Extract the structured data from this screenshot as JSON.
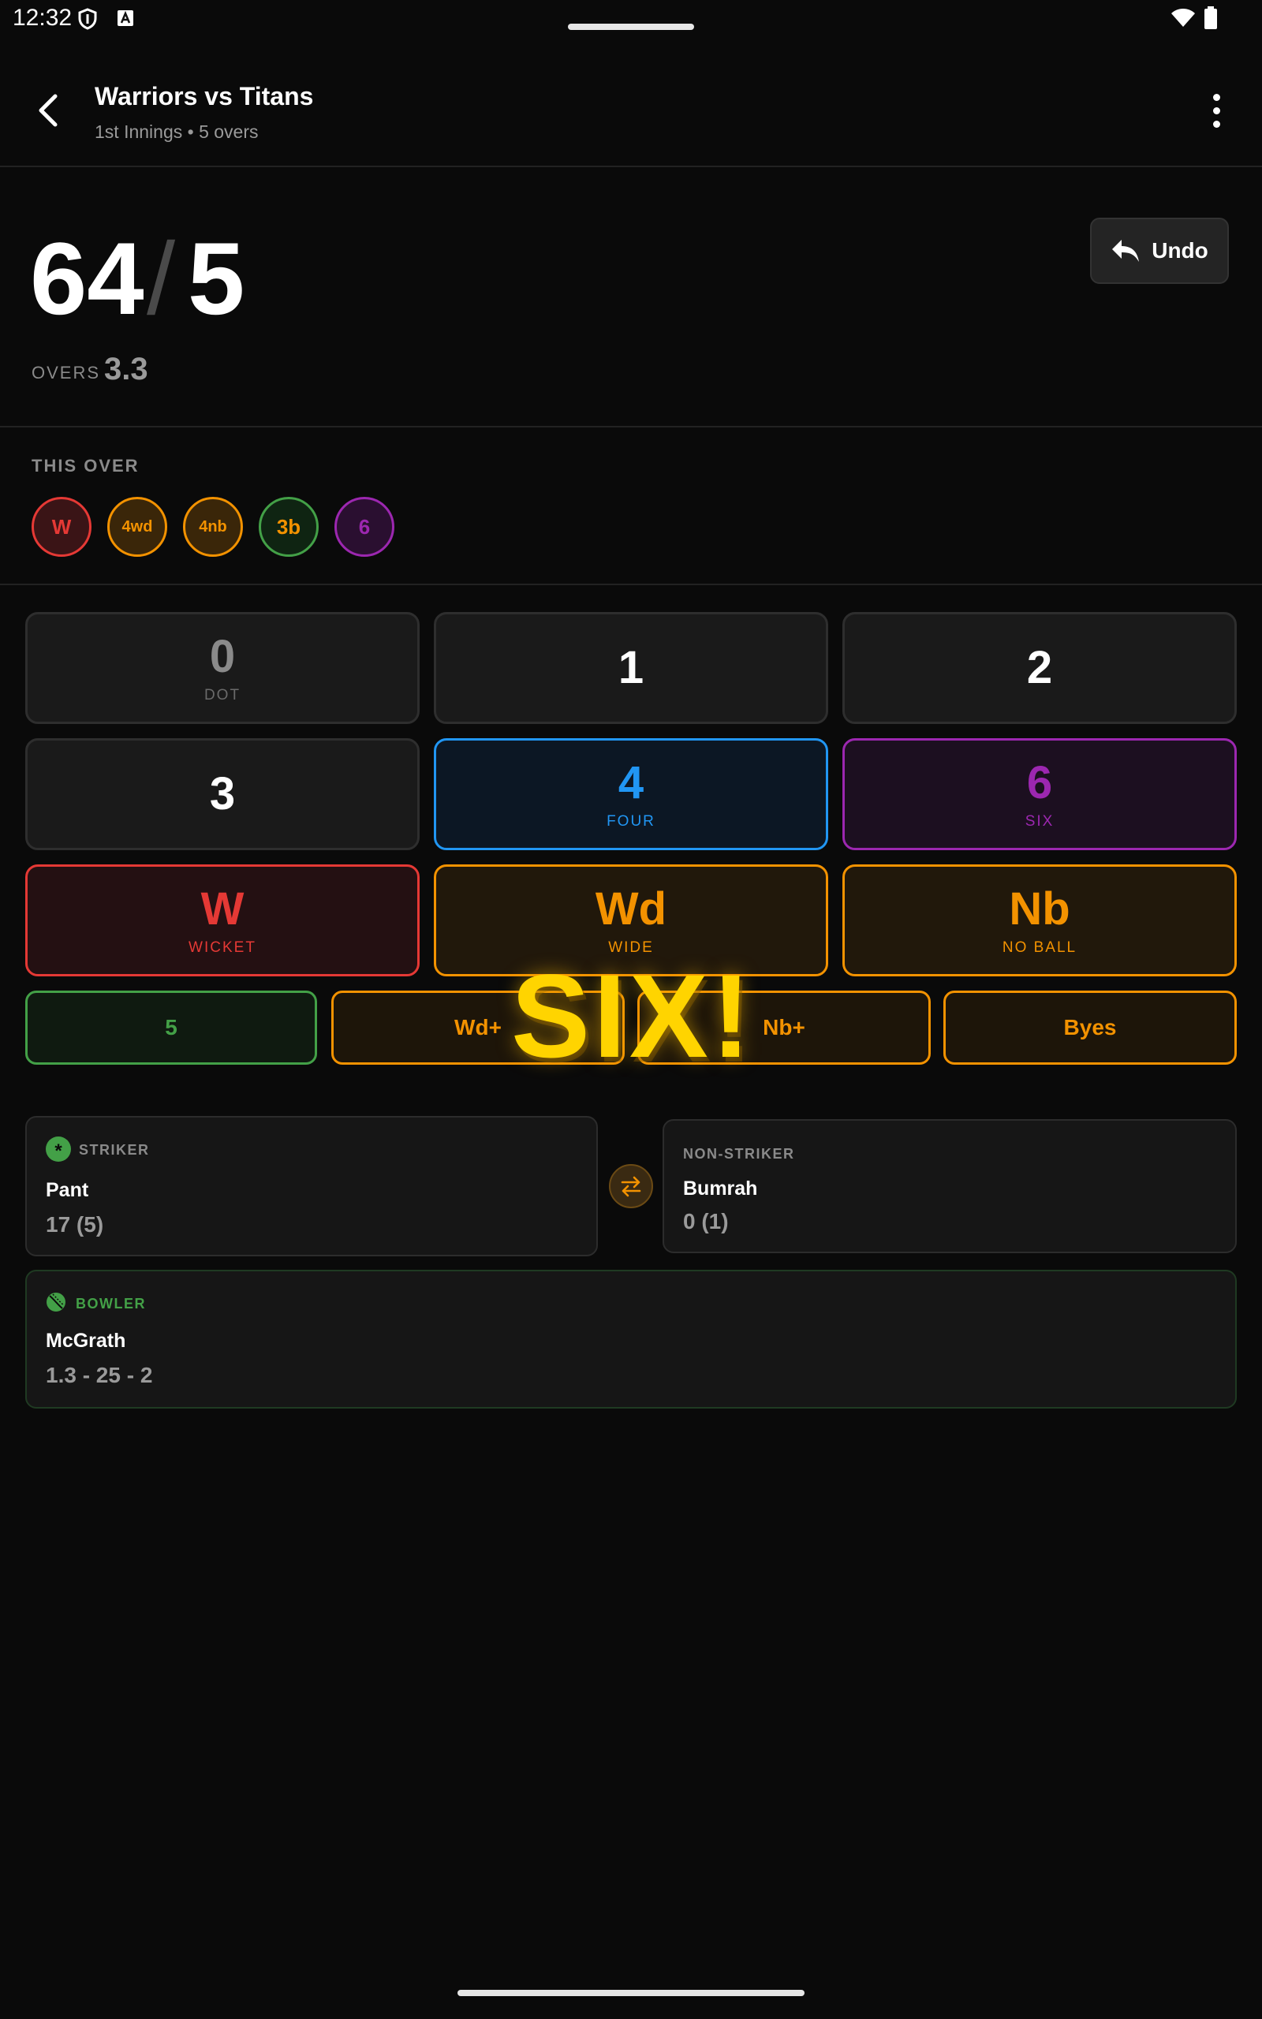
{
  "status_bar": {
    "time": "12:32"
  },
  "header": {
    "title": "Warriors vs Titans",
    "subtitle": "1st Innings • 5 overs"
  },
  "score": {
    "runs": "64",
    "separator": "/",
    "wickets": "5",
    "overs_label": "OVERS",
    "overs_value": "3.3",
    "undo_label": "Undo"
  },
  "this_over": {
    "label": "THIS OVER",
    "balls": [
      {
        "text": "W",
        "color": "#e53935"
      },
      {
        "text": "4wd",
        "color": "#f39200"
      },
      {
        "text": "4nb",
        "color": "#f39200"
      },
      {
        "text": "3b",
        "color": "#43a047"
      },
      {
        "text": "6",
        "color": "#9c27b0"
      }
    ]
  },
  "buttons": {
    "dot": {
      "main": "0",
      "sub": "DOT"
    },
    "one": {
      "main": "1"
    },
    "two": {
      "main": "2"
    },
    "three": {
      "main": "3"
    },
    "four": {
      "main": "4",
      "sub": "FOUR"
    },
    "six": {
      "main": "6",
      "sub": "SIX"
    },
    "wicket": {
      "main": "W",
      "sub": "WICKET"
    },
    "wide": {
      "main": "Wd",
      "sub": "WIDE"
    },
    "noball": {
      "main": "Nb",
      "sub": "NO BALL"
    },
    "five": "5",
    "wide_plus": "Wd+",
    "noball_plus": "Nb+",
    "byes": "Byes"
  },
  "overlay": {
    "text": "SIX!"
  },
  "striker": {
    "label": "STRIKER",
    "name": "Pant",
    "stat": "17 (5)"
  },
  "non_striker": {
    "label": "NON-STRIKER",
    "name": "Bumrah",
    "stat": "0 (1)"
  },
  "bowler": {
    "label": "BOWLER",
    "name": "McGrath",
    "stat": "1.3 - 25 - 2"
  },
  "colors": {
    "wicket": "#e53935",
    "extras": "#f39200",
    "four": "#2196f3",
    "six": "#9c27b0",
    "green": "#43a047",
    "overlay": "#ffd400"
  }
}
